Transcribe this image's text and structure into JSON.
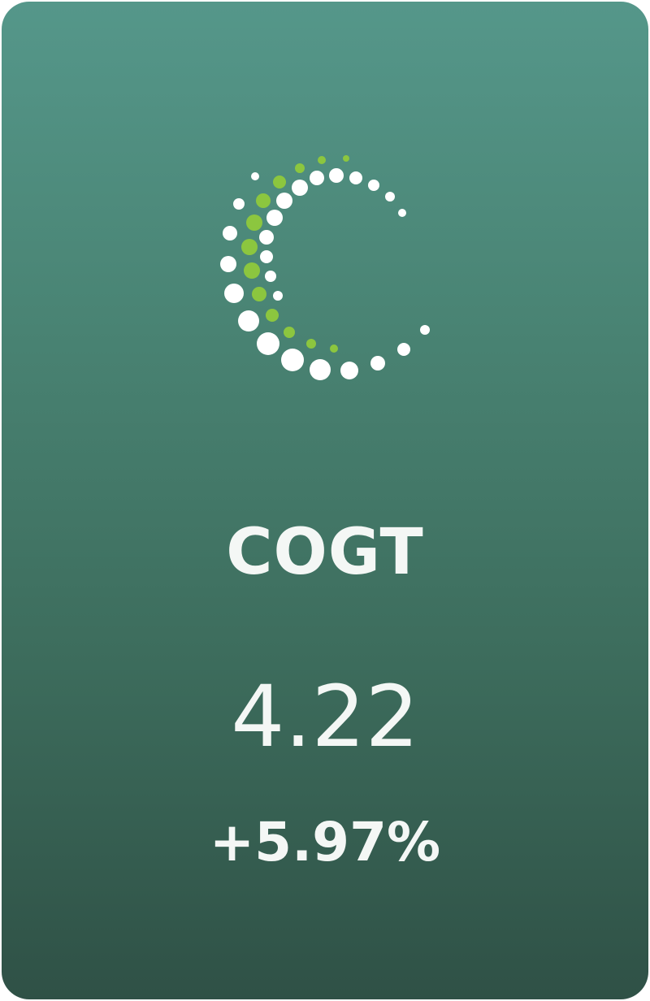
{
  "card": {
    "logo_icon": "dotted-c-logo-icon",
    "ticker": "COGT",
    "price": "4.22",
    "change": "+5.97%"
  },
  "colors": {
    "background_top": "#55978a",
    "background_bottom": "#2f5146",
    "text": "#f4f7f5",
    "logo_white": "#ffffff",
    "logo_green": "#8cc63f"
  }
}
